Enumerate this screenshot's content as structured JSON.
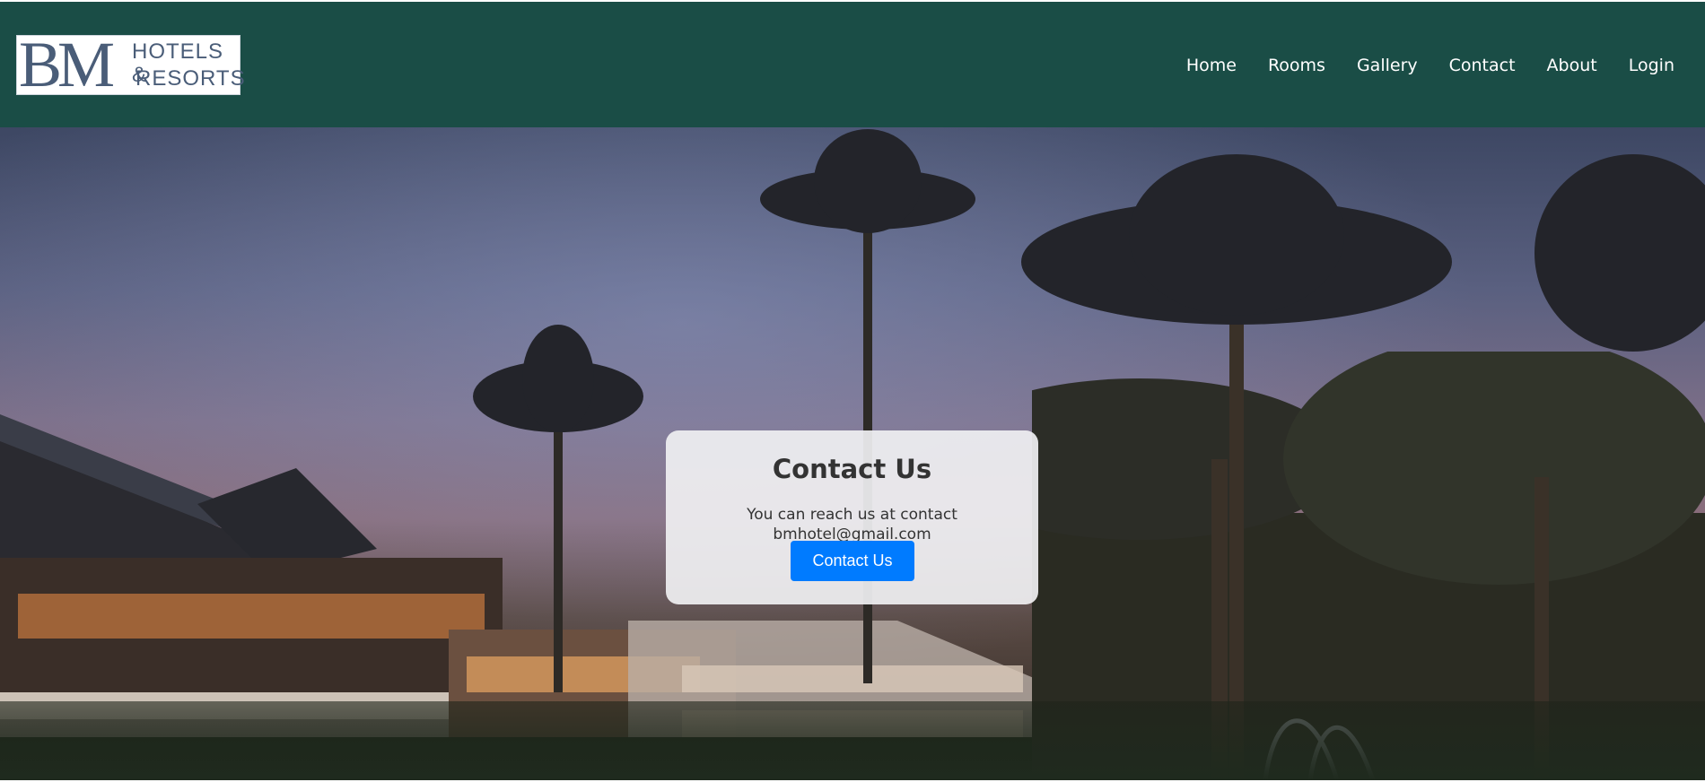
{
  "logo": {
    "initials": "BM",
    "line1": "HOTELS &",
    "line2": "RESORTS"
  },
  "nav": {
    "items": [
      "Home",
      "Rooms",
      "Gallery",
      "Contact",
      "About",
      "Login"
    ]
  },
  "contact": {
    "title": "Contact Us",
    "text": "You can reach us at contact bmhotel@gmail.com",
    "button_label": "Contact Us"
  },
  "colors": {
    "navbar": "#1a4d46",
    "button": "#007bff",
    "logo_text": "#4a5d78"
  }
}
